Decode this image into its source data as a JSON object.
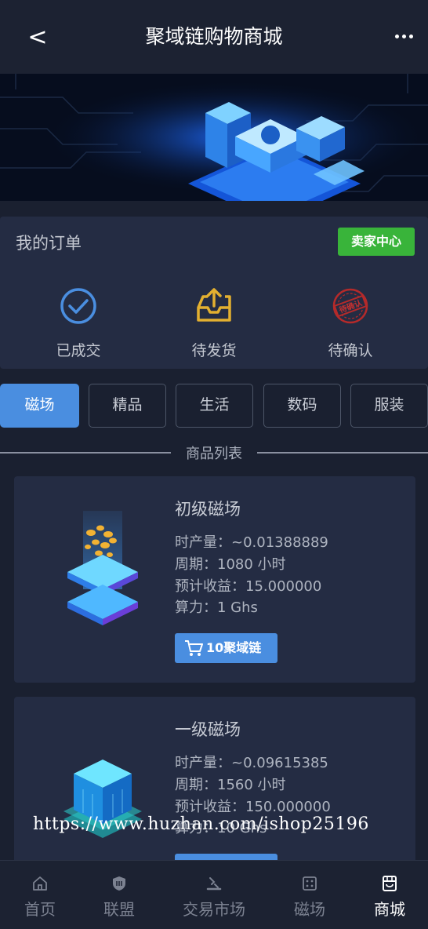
{
  "header": {
    "back_label": "<",
    "title": "聚域链购物商城"
  },
  "orders": {
    "title": "我的订单",
    "seller_center": "卖家中心",
    "items": [
      {
        "label": "已成交",
        "icon": "check-circle-icon"
      },
      {
        "label": "待发货",
        "icon": "outbox-tray-icon"
      },
      {
        "label": "待确认",
        "icon": "stamp-icon",
        "stamp_text": "待确认"
      }
    ]
  },
  "tabs": [
    {
      "label": "磁场",
      "active": true
    },
    {
      "label": "精品",
      "active": false
    },
    {
      "label": "生活",
      "active": false
    },
    {
      "label": "数码",
      "active": false
    },
    {
      "label": "服装",
      "active": false
    }
  ],
  "list_title": "商品列表",
  "products": [
    {
      "name": "初级磁场",
      "output": "时产量：~0.01388889",
      "period": "周期：1080 小时",
      "income": "预计收益：15.000000",
      "power": "算力：1 Ghs",
      "price": "10聚域链"
    },
    {
      "name": "一级磁场",
      "output": "时产量：~0.09615385",
      "period": "周期：1560 小时",
      "income": "预计收益：150.000000",
      "power": "算力：10 Ghs",
      "price": ""
    }
  ],
  "watermark": "https://www.huzhan.com/ishop25196",
  "nav": [
    {
      "label": "首页",
      "icon": "home-icon",
      "active": false
    },
    {
      "label": "联盟",
      "icon": "shield-icon",
      "active": false
    },
    {
      "label": "交易市场",
      "icon": "market-icon",
      "active": false
    },
    {
      "label": "磁场",
      "icon": "field-icon",
      "active": false
    },
    {
      "label": "商城",
      "icon": "shop-icon",
      "active": true
    }
  ],
  "colors": {
    "accent": "#4a8ee0",
    "seller_green": "#39b43a",
    "card_bg": "#242c43",
    "page_bg": "#1a2030"
  }
}
